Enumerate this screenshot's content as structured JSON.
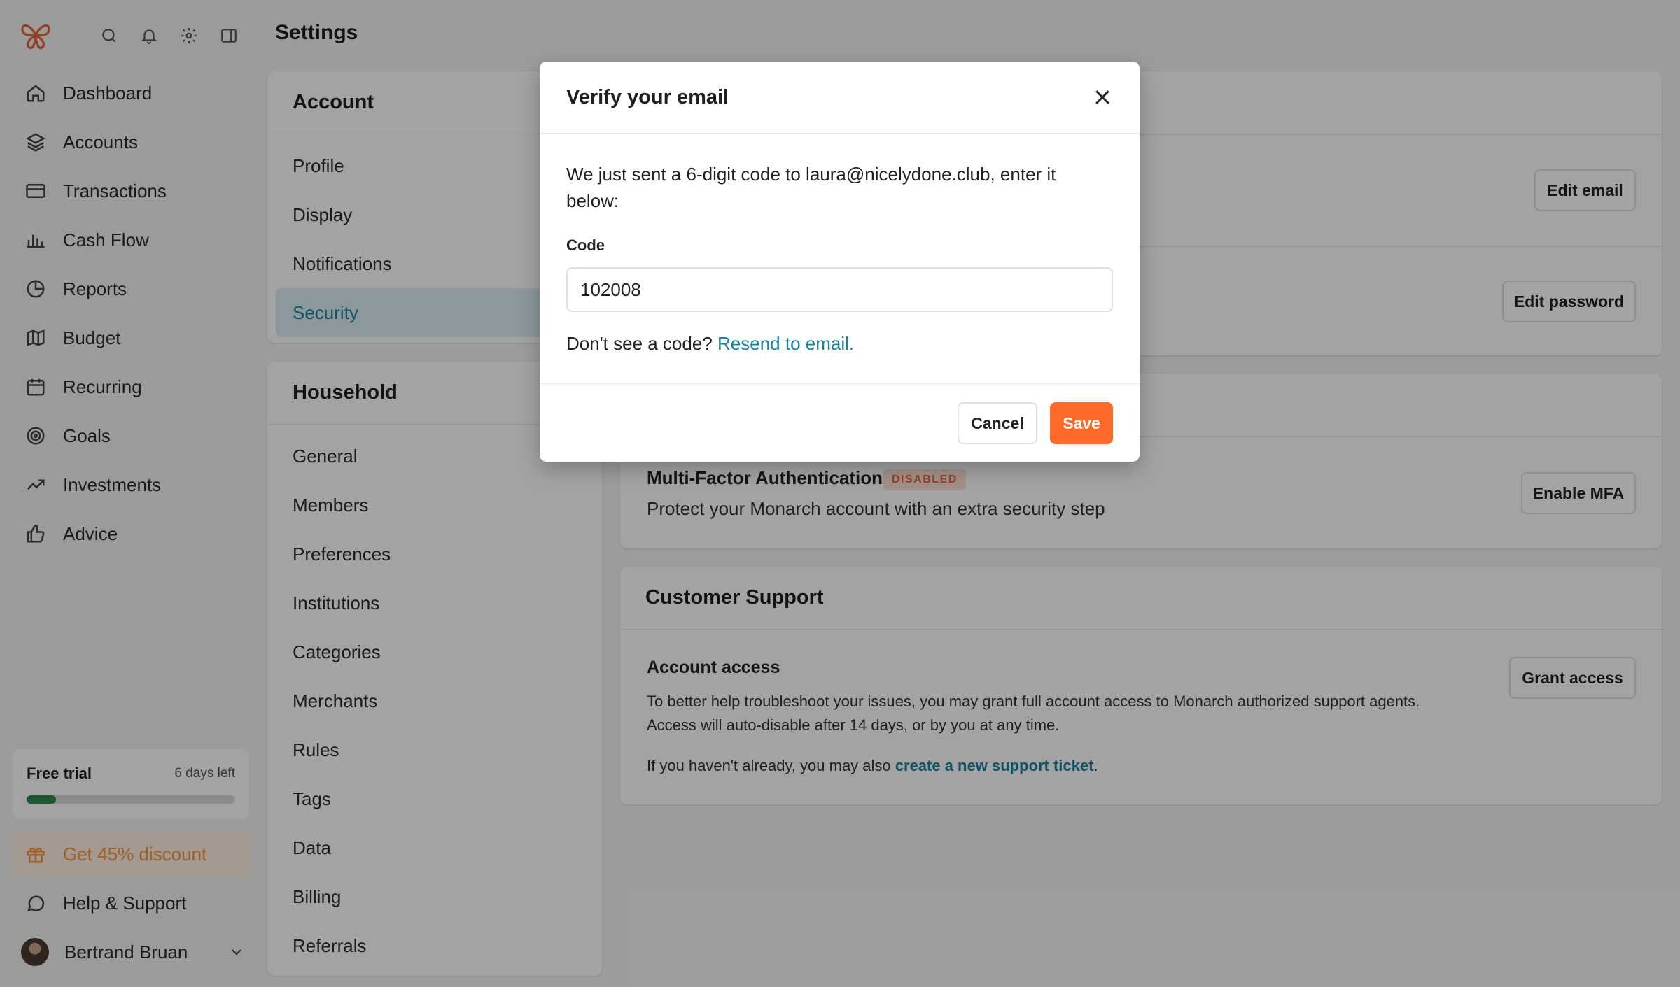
{
  "app": {
    "page_title": "Settings",
    "brand_color": "#e8643a",
    "accent_color": "#18829f"
  },
  "sidebar": {
    "top_icons": [
      "search-icon",
      "bell-icon",
      "gear-icon",
      "sidebar-toggle-icon"
    ],
    "items": [
      {
        "label": "Dashboard",
        "icon": "home-icon"
      },
      {
        "label": "Accounts",
        "icon": "layers-icon"
      },
      {
        "label": "Transactions",
        "icon": "credit-card-icon"
      },
      {
        "label": "Cash Flow",
        "icon": "bar-chart-icon"
      },
      {
        "label": "Reports",
        "icon": "pie-chart-icon"
      },
      {
        "label": "Budget",
        "icon": "map-icon"
      },
      {
        "label": "Recurring",
        "icon": "calendar-icon"
      },
      {
        "label": "Goals",
        "icon": "target-icon"
      },
      {
        "label": "Investments",
        "icon": "trending-up-icon"
      },
      {
        "label": "Advice",
        "icon": "thumbs-up-icon"
      }
    ],
    "trial": {
      "title": "Free trial",
      "days_left": "6 days left",
      "progress": 0.14
    },
    "discount_label": "Get 45% discount",
    "help_label": "Help & Support",
    "user_name": "Bertrand Bruan"
  },
  "settings_menu": {
    "account": {
      "title": "Account",
      "items": [
        "Profile",
        "Display",
        "Notifications",
        "Security"
      ],
      "active": "Security"
    },
    "household": {
      "title": "Household",
      "items": [
        "General",
        "Members",
        "Preferences",
        "Institutions",
        "Categories",
        "Merchants",
        "Rules",
        "Tags",
        "Data",
        "Billing",
        "Referrals"
      ]
    }
  },
  "security": {
    "edit_email_label": "Edit email",
    "edit_password_label": "Edit password",
    "mfa": {
      "title": "Multi-Factor Authentication",
      "badge": "DISABLED",
      "description": "Protect your Monarch account with an extra security step",
      "button": "Enable MFA"
    }
  },
  "customer_support": {
    "title": "Customer Support",
    "access_title": "Account access",
    "access_description": "To better help troubleshoot your issues, you may grant full account access to Monarch authorized support agents. Access will auto-disable after 14 days, or by you at any time.",
    "grant_button": "Grant access",
    "ticket_prefix": "If you haven't already, you may also ",
    "ticket_link": "create a new support ticket",
    "ticket_suffix": "."
  },
  "modal": {
    "title": "Verify your email",
    "message": "We just sent a 6-digit code to laura@nicelydone.club, enter it below:",
    "code_label": "Code",
    "code_value": "102008",
    "resend_prefix": "Don't see a code? ",
    "resend_link": "Resend to email.",
    "cancel_label": "Cancel",
    "save_label": "Save"
  }
}
